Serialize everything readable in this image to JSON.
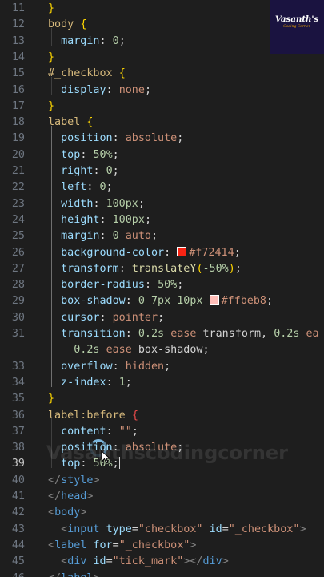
{
  "editor": {
    "lines": [
      {
        "num": "11",
        "tokens": [
          {
            "t": "}",
            "c": "t-br"
          }
        ]
      },
      {
        "num": "12",
        "tokens": [
          {
            "t": "body",
            "c": "t-sel"
          },
          {
            "t": " ",
            "c": "t-p"
          },
          {
            "t": "{",
            "c": "t-br"
          }
        ]
      },
      {
        "num": "13",
        "tokens": [
          {
            "t": "  margin",
            "c": "t-prop"
          },
          {
            "t": ": ",
            "c": "t-p"
          },
          {
            "t": "0",
            "c": "t-num"
          },
          {
            "t": ";",
            "c": "t-p"
          }
        ]
      },
      {
        "num": "14",
        "tokens": [
          {
            "t": "}",
            "c": "t-br"
          }
        ]
      },
      {
        "num": "15",
        "tokens": [
          {
            "t": "#_checkbox",
            "c": "t-sel"
          },
          {
            "t": " ",
            "c": "t-p"
          },
          {
            "t": "{",
            "c": "t-br"
          }
        ]
      },
      {
        "num": "16",
        "tokens": [
          {
            "t": "  display",
            "c": "t-prop"
          },
          {
            "t": ": ",
            "c": "t-p"
          },
          {
            "t": "none",
            "c": "t-val"
          },
          {
            "t": ";",
            "c": "t-p"
          }
        ]
      },
      {
        "num": "17",
        "tokens": [
          {
            "t": "}",
            "c": "t-br"
          }
        ]
      },
      {
        "num": "18",
        "tokens": [
          {
            "t": "label",
            "c": "t-sel"
          },
          {
            "t": " ",
            "c": "t-p"
          },
          {
            "t": "{",
            "c": "t-br"
          }
        ]
      },
      {
        "num": "19",
        "tokens": [
          {
            "t": "  position",
            "c": "t-prop"
          },
          {
            "t": ": ",
            "c": "t-p"
          },
          {
            "t": "absolute",
            "c": "t-val"
          },
          {
            "t": ";",
            "c": "t-p"
          }
        ]
      },
      {
        "num": "20",
        "tokens": [
          {
            "t": "  top",
            "c": "t-prop"
          },
          {
            "t": ": ",
            "c": "t-p"
          },
          {
            "t": "50%",
            "c": "t-num"
          },
          {
            "t": ";",
            "c": "t-p"
          }
        ]
      },
      {
        "num": "21",
        "tokens": [
          {
            "t": "  right",
            "c": "t-prop"
          },
          {
            "t": ": ",
            "c": "t-p"
          },
          {
            "t": "0",
            "c": "t-num"
          },
          {
            "t": ";",
            "c": "t-p"
          }
        ]
      },
      {
        "num": "22",
        "tokens": [
          {
            "t": "  left",
            "c": "t-prop"
          },
          {
            "t": ": ",
            "c": "t-p"
          },
          {
            "t": "0",
            "c": "t-num"
          },
          {
            "t": ";",
            "c": "t-p"
          }
        ]
      },
      {
        "num": "23",
        "tokens": [
          {
            "t": "  width",
            "c": "t-prop"
          },
          {
            "t": ": ",
            "c": "t-p"
          },
          {
            "t": "100px",
            "c": "t-num"
          },
          {
            "t": ";",
            "c": "t-p"
          }
        ]
      },
      {
        "num": "24",
        "tokens": [
          {
            "t": "  height",
            "c": "t-prop"
          },
          {
            "t": ": ",
            "c": "t-p"
          },
          {
            "t": "100px",
            "c": "t-num"
          },
          {
            "t": ";",
            "c": "t-p"
          }
        ]
      },
      {
        "num": "25",
        "tokens": [
          {
            "t": "  margin",
            "c": "t-prop"
          },
          {
            "t": ": ",
            "c": "t-p"
          },
          {
            "t": "0",
            "c": "t-num"
          },
          {
            "t": " ",
            "c": "t-p"
          },
          {
            "t": "auto",
            "c": "t-val"
          },
          {
            "t": ";",
            "c": "t-p"
          }
        ]
      },
      {
        "num": "26",
        "tokens": [
          {
            "t": "  background-color",
            "c": "t-prop"
          },
          {
            "t": ": ",
            "c": "t-p"
          },
          {
            "swatch": "#f72414"
          },
          {
            "t": "#f72414",
            "c": "t-val"
          },
          {
            "t": ";",
            "c": "t-p"
          }
        ]
      },
      {
        "num": "27",
        "tokens": [
          {
            "t": "  transform",
            "c": "t-prop"
          },
          {
            "t": ": ",
            "c": "t-p"
          },
          {
            "t": "translateY",
            "c": "t-fn"
          },
          {
            "t": "(",
            "c": "t-br"
          },
          {
            "t": "-50%",
            "c": "t-num"
          },
          {
            "t": ")",
            "c": "t-br"
          },
          {
            "t": ";",
            "c": "t-p"
          }
        ]
      },
      {
        "num": "28",
        "tokens": [
          {
            "t": "  border-radius",
            "c": "t-prop"
          },
          {
            "t": ": ",
            "c": "t-p"
          },
          {
            "t": "50%",
            "c": "t-num"
          },
          {
            "t": ";",
            "c": "t-p"
          }
        ]
      },
      {
        "num": "29",
        "tokens": [
          {
            "t": "  box-shadow",
            "c": "t-prop"
          },
          {
            "t": ": ",
            "c": "t-p"
          },
          {
            "t": "0",
            "c": "t-num"
          },
          {
            "t": " ",
            "c": "t-p"
          },
          {
            "t": "7px",
            "c": "t-num"
          },
          {
            "t": " ",
            "c": "t-p"
          },
          {
            "t": "10px",
            "c": "t-num"
          },
          {
            "t": " ",
            "c": "t-p"
          },
          {
            "swatch": "#ffbeb8"
          },
          {
            "t": "#ffbeb8",
            "c": "t-val"
          },
          {
            "t": ";",
            "c": "t-p"
          }
        ]
      },
      {
        "num": "30",
        "tokens": [
          {
            "t": "  cursor",
            "c": "t-prop"
          },
          {
            "t": ": ",
            "c": "t-p"
          },
          {
            "t": "pointer",
            "c": "t-val"
          },
          {
            "t": ";",
            "c": "t-p"
          }
        ]
      },
      {
        "num": "31",
        "tokens": [
          {
            "t": "  transition",
            "c": "t-prop"
          },
          {
            "t": ": ",
            "c": "t-p"
          },
          {
            "t": "0.2s",
            "c": "t-num"
          },
          {
            "t": " ",
            "c": "t-p"
          },
          {
            "t": "ease",
            "c": "t-val"
          },
          {
            "t": " transform, ",
            "c": "t-p"
          },
          {
            "t": "0.2s",
            "c": "t-num"
          },
          {
            "t": " ",
            "c": "t-p"
          },
          {
            "t": "ea",
            "c": "t-val"
          }
        ]
      },
      {
        "num": "",
        "tokens": [
          {
            "t": "    0.2s",
            "c": "t-num"
          },
          {
            "t": " ",
            "c": "t-p"
          },
          {
            "t": "ease",
            "c": "t-val"
          },
          {
            "t": " box-shadow;",
            "c": "t-p"
          }
        ]
      },
      {
        "num": "33",
        "tokens": [
          {
            "t": "  overflow",
            "c": "t-prop"
          },
          {
            "t": ": ",
            "c": "t-p"
          },
          {
            "t": "hidden",
            "c": "t-val"
          },
          {
            "t": ";",
            "c": "t-p"
          }
        ]
      },
      {
        "num": "34",
        "tokens": [
          {
            "t": "  z-index",
            "c": "t-prop"
          },
          {
            "t": ": ",
            "c": "t-p"
          },
          {
            "t": "1",
            "c": "t-num"
          },
          {
            "t": ";",
            "c": "t-p"
          }
        ]
      },
      {
        "num": "35",
        "tokens": [
          {
            "t": "}",
            "c": "t-br"
          }
        ]
      },
      {
        "num": "36",
        "tokens": [
          {
            "t": "label:before",
            "c": "t-sel"
          },
          {
            "t": " ",
            "c": "t-p"
          },
          {
            "t": "{",
            "c": "t-err"
          }
        ]
      },
      {
        "num": "37",
        "tokens": [
          {
            "t": "  content",
            "c": "t-prop"
          },
          {
            "t": ": ",
            "c": "t-p"
          },
          {
            "t": "\"\"",
            "c": "t-str"
          },
          {
            "t": ";",
            "c": "t-p"
          }
        ]
      },
      {
        "num": "38",
        "tokens": [
          {
            "t": "  position",
            "c": "t-prop"
          },
          {
            "t": ": ",
            "c": "t-p"
          },
          {
            "t": "absolute",
            "c": "t-val"
          },
          {
            "t": ";",
            "c": "t-p"
          }
        ]
      },
      {
        "num": "39",
        "current": true,
        "tokens": [
          {
            "t": "  top",
            "c": "t-prop"
          },
          {
            "t": ": ",
            "c": "t-p"
          },
          {
            "t": "50%",
            "c": "t-num"
          },
          {
            "t": ";",
            "c": "t-p"
          },
          {
            "cursor": true
          }
        ]
      },
      {
        "num": "40",
        "tokens": [
          {
            "t": "</",
            "c": "t-gray"
          },
          {
            "t": "style",
            "c": "t-tag"
          },
          {
            "t": ">",
            "c": "t-gray"
          }
        ]
      },
      {
        "num": "41",
        "tokens": [
          {
            "t": "</",
            "c": "t-gray"
          },
          {
            "t": "head",
            "c": "t-tag"
          },
          {
            "t": ">",
            "c": "t-gray"
          }
        ]
      },
      {
        "num": "42",
        "tokens": [
          {
            "t": "<",
            "c": "t-gray"
          },
          {
            "t": "body",
            "c": "t-tag"
          },
          {
            "t": ">",
            "c": "t-gray"
          }
        ]
      },
      {
        "num": "43",
        "tokens": [
          {
            "t": "  <",
            "c": "t-gray"
          },
          {
            "t": "input",
            "c": "t-tag"
          },
          {
            "t": " ",
            "c": "t-p"
          },
          {
            "t": "type",
            "c": "t-attr"
          },
          {
            "t": "=",
            "c": "t-p"
          },
          {
            "t": "\"checkbox\"",
            "c": "t-str"
          },
          {
            "t": " ",
            "c": "t-p"
          },
          {
            "t": "id",
            "c": "t-attr"
          },
          {
            "t": "=",
            "c": "t-p"
          },
          {
            "t": "\"_checkbox\"",
            "c": "t-str"
          },
          {
            "t": ">",
            "c": "t-gray"
          }
        ]
      },
      {
        "num": "44",
        "tokens": [
          {
            "t": "<",
            "c": "t-gray"
          },
          {
            "t": "label",
            "c": "t-tag"
          },
          {
            "t": " ",
            "c": "t-p"
          },
          {
            "t": "for",
            "c": "t-attr"
          },
          {
            "t": "=",
            "c": "t-p"
          },
          {
            "t": "\"_checkbox\"",
            "c": "t-str"
          },
          {
            "t": ">",
            "c": "t-gray"
          }
        ]
      },
      {
        "num": "45",
        "tokens": [
          {
            "t": "  <",
            "c": "t-gray"
          },
          {
            "t": "div",
            "c": "t-tag"
          },
          {
            "t": " ",
            "c": "t-p"
          },
          {
            "t": "id",
            "c": "t-attr"
          },
          {
            "t": "=",
            "c": "t-p"
          },
          {
            "t": "\"tick_mark\"",
            "c": "t-str"
          },
          {
            "t": "></",
            "c": "t-gray"
          },
          {
            "t": "div",
            "c": "t-tag"
          },
          {
            "t": ">",
            "c": "t-gray"
          }
        ]
      },
      {
        "num": "46",
        "tokens": [
          {
            "t": "</",
            "c": "t-gray"
          },
          {
            "t": "label",
            "c": "t-tag"
          },
          {
            "t": ">",
            "c": "t-gray"
          }
        ]
      }
    ]
  },
  "overlay": {
    "watermark": "Vasanthscodingcorner",
    "logo_title": "Vasanth's",
    "logo_subtitle": "Coding Corner",
    "spinner_icon": "loading-spinner-icon",
    "pointer_icon": "mouse-pointer-icon"
  },
  "colors": {
    "background": "#1e1e1e",
    "line_number": "#6e7681",
    "selector": "#d7ba7d",
    "property": "#9cdcfe",
    "value": "#ce9178",
    "number": "#b5cea8",
    "tag": "#569cd6",
    "bracket": "#ffd700"
  }
}
